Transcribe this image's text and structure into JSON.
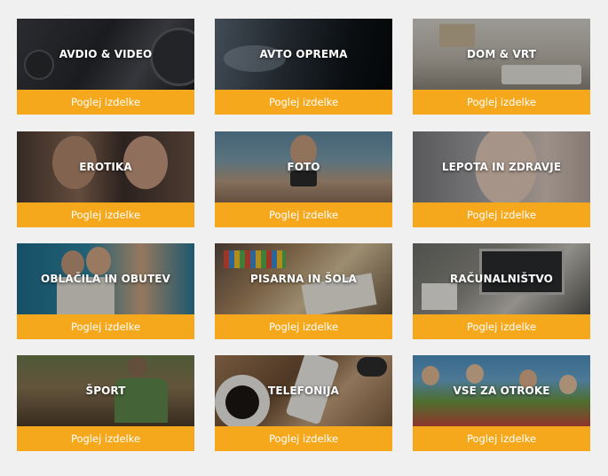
{
  "button_label": "Poglej izdelke",
  "colors": {
    "page_background": "#f0f0f0",
    "button": "#f6a81c",
    "title_text": "#ffffff"
  },
  "categories": [
    {
      "title": "AVDIO & VIDEO"
    },
    {
      "title": "AVTO OPREMA"
    },
    {
      "title": "DOM & VRT"
    },
    {
      "title": "EROTIKA"
    },
    {
      "title": "FOTO"
    },
    {
      "title": "LEPOTA IN ZDRAVJE"
    },
    {
      "title": "OBLAČILA IN OBUTEV"
    },
    {
      "title": "PISARNA IN ŠOLA"
    },
    {
      "title": "RAČUNALNIŠTVO"
    },
    {
      "title": "ŠPORT"
    },
    {
      "title": "TELEFONIJA"
    },
    {
      "title": "VSE ZA OTROKE"
    }
  ]
}
